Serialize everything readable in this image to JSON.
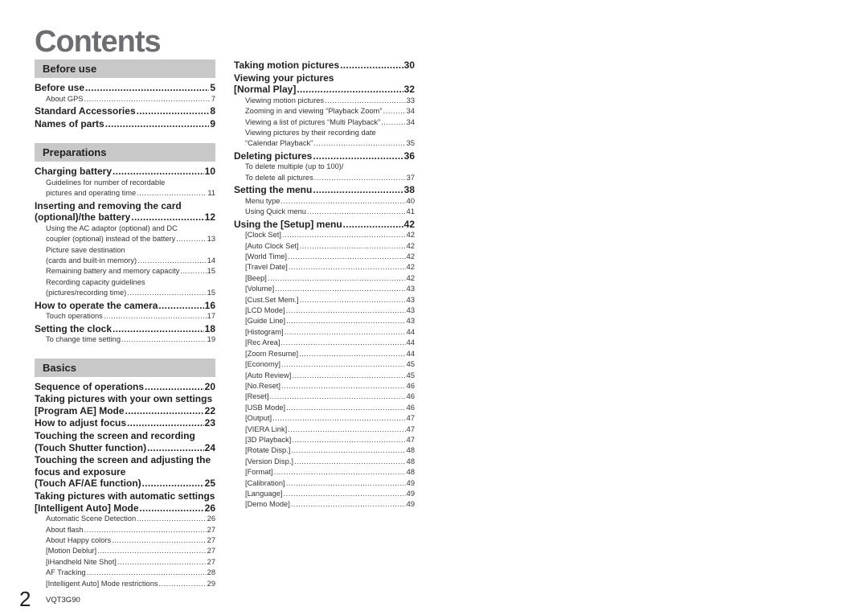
{
  "page": {
    "title": "Contents",
    "page_number": "2",
    "doc_code": "VQT3G90"
  },
  "left": {
    "sections": [
      {
        "header": "Before use",
        "entries": [
          {
            "type": "main",
            "label": "Before use",
            "page": "5"
          },
          {
            "type": "sub",
            "label": "About GPS",
            "page": "7"
          },
          {
            "type": "main",
            "label": "Standard Accessories",
            "page": "8"
          },
          {
            "type": "main",
            "label": "Names of parts",
            "page": "9"
          }
        ]
      },
      {
        "header": "Preparations",
        "entries": [
          {
            "type": "main",
            "label": "Charging battery",
            "page": "10"
          },
          {
            "type": "sub",
            "pre": "Guidelines for number of recordable",
            "label": "pictures and operating time",
            "page": "11"
          },
          {
            "type": "main",
            "pre": "Inserting and removing the card",
            "label": "(optional)/the battery",
            "page": "12"
          },
          {
            "type": "sub",
            "pre": "Using the AC adaptor (optional) and DC",
            "label": "coupler (optional) instead of the battery",
            "page": "13"
          },
          {
            "type": "sub",
            "pre": "Picture save destination",
            "label": "(cards and built-in memory)",
            "page": "14"
          },
          {
            "type": "sub",
            "label": "Remaining battery and memory capacity",
            "page": "15"
          },
          {
            "type": "sub",
            "pre": "Recording capacity guidelines",
            "label": "(pictures/recording time)",
            "page": "15"
          },
          {
            "type": "main",
            "label": "How to operate the camera",
            "page": "16"
          },
          {
            "type": "sub",
            "label": "Touch operations",
            "page": "17"
          },
          {
            "type": "main",
            "label": "Setting the clock",
            "page": "18"
          },
          {
            "type": "sub",
            "label": "To change time setting",
            "page": "19"
          }
        ]
      },
      {
        "header": "Basics",
        "entries": [
          {
            "type": "main",
            "label": "Sequence of operations",
            "page": "20"
          },
          {
            "type": "main",
            "pre": "Taking pictures with your own settings",
            "label": "[Program AE] Mode",
            "page": "22"
          },
          {
            "type": "main",
            "label": "How to adjust focus",
            "page": "23"
          },
          {
            "type": "main",
            "pre": "Touching the screen and recording",
            "label": "(Touch Shutter function)",
            "page": "24"
          },
          {
            "type": "main",
            "pre": "Touching the screen and adjusting the",
            "pre2": "focus and exposure",
            "label": "(Touch AF/AE function)",
            "page": "25"
          },
          {
            "type": "main",
            "pre": "Taking pictures with automatic settings",
            "label": "[Intelligent Auto] Mode",
            "page": "26"
          },
          {
            "type": "sub",
            "label": "Automatic Scene Detection",
            "page": "26"
          },
          {
            "type": "sub",
            "label": "About flash",
            "page": "27"
          },
          {
            "type": "sub",
            "label": "About Happy colors",
            "page": "27"
          },
          {
            "type": "sub",
            "label": "[Motion Deblur]",
            "page": "27"
          },
          {
            "type": "sub",
            "label": "[iHandheld Nite Shot]",
            "page": "27"
          },
          {
            "type": "sub",
            "label": "AF Tracking",
            "page": "28"
          },
          {
            "type": "sub",
            "label": "[Intelligent Auto] Mode restrictions",
            "page": "29"
          }
        ]
      }
    ]
  },
  "right": {
    "entries": [
      {
        "type": "main",
        "label": "Taking motion pictures",
        "page": "30"
      },
      {
        "type": "main",
        "pre": "Viewing your pictures",
        "label": "[Normal Play]",
        "page": "32"
      },
      {
        "type": "sub",
        "label": "Viewing motion pictures",
        "page": "33"
      },
      {
        "type": "sub",
        "label": "Zooming in and viewing “Playback Zoom”",
        "page": "34"
      },
      {
        "type": "sub",
        "label": "Viewing a list of pictures “Multi Playback”",
        "page": "34"
      },
      {
        "type": "sub",
        "pre": "Viewing pictures by their recording date",
        "label": "“Calendar Playback”",
        "page": "35"
      },
      {
        "type": "main",
        "label": "Deleting pictures",
        "page": "36"
      },
      {
        "type": "sub",
        "pre": "To delete multiple (up to 100)/",
        "label": "To delete all pictures",
        "page": "37"
      },
      {
        "type": "main",
        "label": "Setting the menu",
        "page": "38"
      },
      {
        "type": "sub",
        "label": "Menu type",
        "page": "40"
      },
      {
        "type": "sub",
        "label": "Using Quick menu",
        "page": "41"
      },
      {
        "type": "main",
        "label": "Using the [Setup] menu",
        "page": "42"
      },
      {
        "type": "sub",
        "label": "[Clock Set]",
        "page": "42"
      },
      {
        "type": "sub",
        "label": "[Auto Clock Set]",
        "page": "42"
      },
      {
        "type": "sub",
        "label": "[World Time]",
        "page": "42"
      },
      {
        "type": "sub",
        "label": "[Travel Date]",
        "page": "42"
      },
      {
        "type": "sub",
        "label": "[Beep]",
        "page": "42"
      },
      {
        "type": "sub",
        "label": "[Volume]",
        "page": "43"
      },
      {
        "type": "sub",
        "label": "[Cust.Set Mem.]",
        "page": "43"
      },
      {
        "type": "sub",
        "label": "[LCD Mode]",
        "page": "43"
      },
      {
        "type": "sub",
        "label": "[Guide Line]",
        "page": "43"
      },
      {
        "type": "sub",
        "label": "[Histogram]",
        "page": "44"
      },
      {
        "type": "sub",
        "label": "[Rec Area]",
        "page": "44"
      },
      {
        "type": "sub",
        "label": "[Zoom Resume]",
        "page": "44"
      },
      {
        "type": "sub",
        "label": "[Economy]",
        "page": "45"
      },
      {
        "type": "sub",
        "label": "[Auto Review]",
        "page": "45"
      },
      {
        "type": "sub",
        "label": "[No.Reset]",
        "page": "46"
      },
      {
        "type": "sub",
        "label": "[Reset]",
        "page": "46"
      },
      {
        "type": "sub",
        "label": "[USB Mode]",
        "page": "46"
      },
      {
        "type": "sub",
        "label": "[Output]",
        "page": "47"
      },
      {
        "type": "sub",
        "label": "[VIERA Link]",
        "page": "47"
      },
      {
        "type": "sub",
        "label": "[3D Playback]",
        "page": "47"
      },
      {
        "type": "sub",
        "label": "[Rotate Disp.]",
        "page": "48"
      },
      {
        "type": "sub",
        "label": "[Version Disp.]",
        "page": "48"
      },
      {
        "type": "sub",
        "label": "[Format]",
        "page": "48"
      },
      {
        "type": "sub",
        "label": "[Calibration]",
        "page": "49"
      },
      {
        "type": "sub",
        "label": "[Language]",
        "page": "49"
      },
      {
        "type": "sub",
        "label": "[Demo Mode]",
        "page": "49"
      }
    ]
  }
}
